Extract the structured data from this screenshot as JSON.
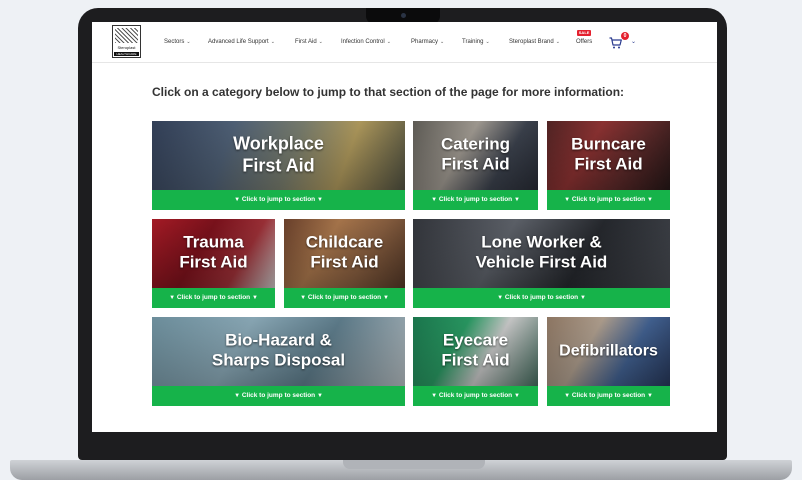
{
  "header": {
    "logo": {
      "brand": "Steroplast",
      "sub": "HEALTHCARE"
    },
    "nav": [
      {
        "label": "Sectors"
      },
      {
        "label": "Advanced Life Support"
      },
      {
        "label": "First Aid"
      },
      {
        "label": "Infection Control"
      },
      {
        "label": "Pharmacy"
      },
      {
        "label": "Training"
      },
      {
        "label": "Steroplast Brand"
      }
    ],
    "offers": {
      "badge": "SALE",
      "label": "Offers"
    },
    "cart": {
      "count": "0"
    }
  },
  "intro": "Click on a category below to jump to that section of the page for more information:",
  "tiles": [
    {
      "title_line1": "Workplace",
      "title_line2": "First Aid",
      "cta": "Click to jump to section"
    },
    {
      "title_line1": "Catering",
      "title_line2": "First Aid",
      "cta": "Click to jump to section"
    },
    {
      "title_line1": "Burncare",
      "title_line2": "First Aid",
      "cta": "Click to jump to section"
    },
    {
      "title_line1": "Trauma",
      "title_line2": "First Aid",
      "cta": "Click to jump to section"
    },
    {
      "title_line1": "Childcare",
      "title_line2": "First Aid",
      "cta": "Click to jump to section"
    },
    {
      "title_line1": "Lone Worker &",
      "title_line2": "Vehicle First Aid",
      "cta": "Click to jump to section"
    },
    {
      "title_line1": "Bio-Hazard &",
      "title_line2": "Sharps Disposal",
      "cta": "Click to jump to section"
    },
    {
      "title_line1": "Eyecare",
      "title_line2": "First Aid",
      "cta": "Click to jump to section"
    },
    {
      "title_line1": "Defibrillators",
      "title_line2": "",
      "cta": "Click to jump to section"
    }
  ],
  "colors": {
    "accent_green": "#16b34a",
    "sale_red": "#e4202e"
  },
  "icons": [
    "cart-icon",
    "chevron-down-icon",
    "triangle-down-icon"
  ]
}
